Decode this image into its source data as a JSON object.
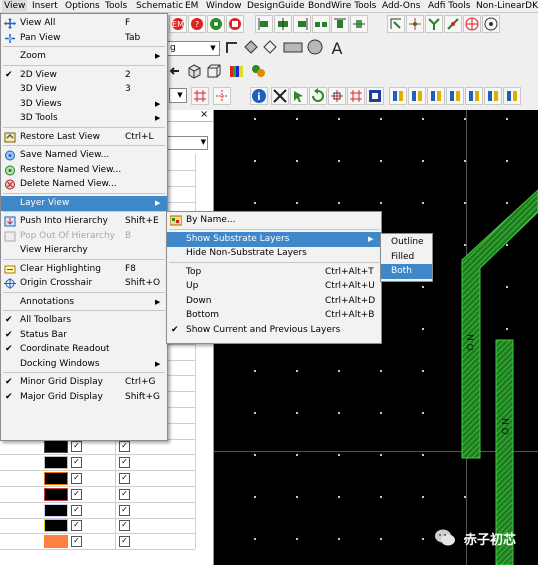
{
  "menubar": {
    "items": [
      "View",
      "Insert",
      "Options",
      "Tools",
      "Schematic",
      "EM",
      "Window",
      "DesignGuide",
      "BondWire Tools",
      "Add-Ons",
      "Adfi Tools",
      "Non-LinearDK"
    ]
  },
  "toolbar": {
    "layer_combo_value": "g"
  },
  "view_menu": {
    "items": [
      {
        "label": "View All",
        "shortcut": "F",
        "icon": "view-all-icon"
      },
      {
        "label": "Pan View",
        "shortcut": "Tab",
        "icon": "pan-icon"
      },
      {
        "label": "Zoom",
        "submenu": true
      },
      {
        "label": "2D View",
        "shortcut": "2",
        "checked": true
      },
      {
        "label": "3D View",
        "shortcut": "3"
      },
      {
        "label": "3D Views",
        "submenu": true
      },
      {
        "label": "3D Tools",
        "submenu": true
      },
      {
        "label": "Restore Last View",
        "shortcut": "Ctrl+L",
        "icon": "restore-icon"
      },
      {
        "label": "Save Named View...",
        "icon": "save-view-icon"
      },
      {
        "label": "Restore Named View...",
        "icon": "restore-view-icon"
      },
      {
        "label": "Delete Named View...",
        "icon": "delete-view-icon"
      },
      {
        "label": "Layer View",
        "submenu": true,
        "highlighted": true
      },
      {
        "label": "Push Into Hierarchy",
        "shortcut": "Shift+E",
        "icon": "push-icon"
      },
      {
        "label": "Pop Out Of Hierarchy",
        "shortcut": "B",
        "disabled": true,
        "icon": "pop-icon"
      },
      {
        "label": "View Hierarchy"
      },
      {
        "label": "Clear Highlighting",
        "shortcut": "F8",
        "icon": "clear-icon"
      },
      {
        "label": "Origin Crosshair",
        "shortcut": "Shift+O",
        "icon": "crosshair-icon"
      },
      {
        "label": "Annotations",
        "submenu": true
      },
      {
        "label": "All Toolbars",
        "checked": true
      },
      {
        "label": "Status Bar",
        "checked": true
      },
      {
        "label": "Coordinate Readout",
        "checked": true
      },
      {
        "label": "Docking Windows",
        "submenu": true
      },
      {
        "label": "Minor Grid Display",
        "shortcut": "Ctrl+G",
        "checked": true
      },
      {
        "label": "Major Grid Display",
        "shortcut": "Shift+G",
        "checked": true
      }
    ]
  },
  "layer_view_menu": {
    "items": [
      {
        "label": "By Name...",
        "icon": "by-name-icon"
      },
      {
        "label": "Show Substrate Layers",
        "submenu": true,
        "highlighted": true
      },
      {
        "label": "Hide Non-Substrate Layers"
      },
      {
        "label": "Top",
        "shortcut": "Ctrl+Alt+T"
      },
      {
        "label": "Up",
        "shortcut": "Ctrl+Alt+U"
      },
      {
        "label": "Down",
        "shortcut": "Ctrl+Alt+D"
      },
      {
        "label": "Bottom",
        "shortcut": "Ctrl+Alt+B"
      },
      {
        "label": "Show Current and Previous Layers",
        "checked": true
      }
    ]
  },
  "substrate_menu": {
    "items": [
      {
        "label": "Outline"
      },
      {
        "label": "Filled"
      },
      {
        "label": "Both",
        "highlighted": true
      }
    ]
  },
  "layer_panel": {
    "rows": [
      {
        "color": "#f5c400",
        "visible": true,
        "selectable": true
      },
      {
        "color": "#4a4a4a",
        "visible": true,
        "selectable": true
      },
      {
        "color": "#c0c0c0",
        "visible": true,
        "selectable": true
      },
      {
        "color": "#e67300",
        "visible": true,
        "selectable": true
      },
      {
        "color": "#c04040",
        "visible": true,
        "selectable": true
      },
      {
        "color": "#d0d0ff",
        "visible": true,
        "selectable": true
      },
      {
        "color": "#d8d800",
        "visible": true,
        "selectable": true
      },
      {
        "color": "#ff8040",
        "visible": true,
        "selectable": true
      }
    ]
  },
  "canvas": {
    "trace_text_1": "N O",
    "trace_text_2": "N  O"
  },
  "watermark": {
    "text": "赤子初芯"
  },
  "colors": {
    "menu_highlight": "#3e87c8",
    "trace_green": "#2aa02a",
    "canvas_bg": "#000000"
  }
}
